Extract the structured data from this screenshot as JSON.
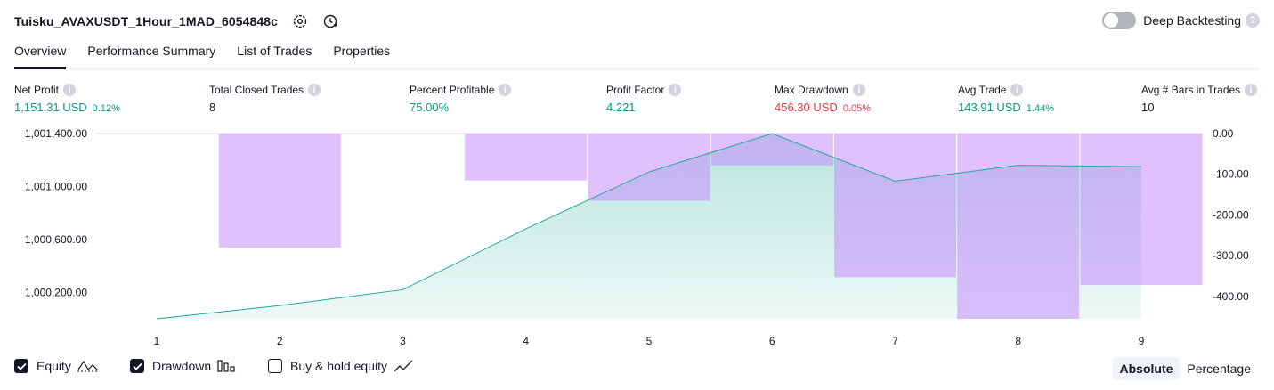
{
  "header": {
    "strategy_name": "Tuisku_AVAXUSDT_1Hour_1MAD_6054848c",
    "deep_backtesting_label": "Deep Backtesting",
    "deep_backtesting_on": false
  },
  "tabs": [
    {
      "label": "Overview",
      "active": true
    },
    {
      "label": "Performance Summary",
      "active": false
    },
    {
      "label": "List of Trades",
      "active": false
    },
    {
      "label": "Properties",
      "active": false
    }
  ],
  "stats": [
    {
      "label": "Net Profit",
      "value": "1,151.31 USD",
      "pct": "0.12%",
      "color": "green"
    },
    {
      "label": "Total Closed Trades",
      "value": "8",
      "pct": "",
      "color": "dark"
    },
    {
      "label": "Percent Profitable",
      "value": "75.00%",
      "pct": "",
      "color": "green"
    },
    {
      "label": "Profit Factor",
      "value": "4.221",
      "pct": "",
      "color": "green"
    },
    {
      "label": "Max Drawdown",
      "value": "456.30 USD",
      "pct": "0.05%",
      "color": "red"
    },
    {
      "label": "Avg Trade",
      "value": "143.91 USD",
      "pct": "1.44%",
      "color": "green"
    },
    {
      "label": "Avg # Bars in Trades",
      "value": "10",
      "pct": "",
      "color": "dark"
    }
  ],
  "chart_data": {
    "type": "area",
    "x": [
      1,
      2,
      3,
      4,
      5,
      6,
      7,
      8,
      9
    ],
    "left_axis": {
      "ticks": [
        "1,001,400.00",
        "1,001,000.00",
        "1,000,600.00",
        "1,000,200.00"
      ],
      "tick_values": [
        1001400,
        1001000,
        1000600,
        1000200
      ],
      "range": [
        1000000,
        1001400
      ]
    },
    "right_axis": {
      "ticks": [
        "0.00",
        "-100.00",
        "-200.00",
        "-300.00",
        "-400.00"
      ],
      "tick_values": [
        0,
        -100,
        -200,
        -300,
        -400
      ],
      "range": [
        -455,
        0
      ]
    },
    "series": [
      {
        "name": "Equity",
        "axis": "left",
        "values": [
          1000000,
          1000100,
          1000220,
          1000680,
          1001110,
          1001400,
          1001040,
          1001160,
          1001150
        ]
      },
      {
        "name": "Drawdown",
        "axis": "right",
        "values": [
          0,
          -280,
          0,
          -115,
          -165,
          -78,
          -353,
          -455,
          -372
        ]
      }
    ],
    "grid": false,
    "colors": {
      "equity_line": "#22ab94",
      "equity_fill": "#22ab94",
      "drawdown": "#c68cff",
      "baseline": "#f7cdea"
    }
  },
  "legend": [
    {
      "label": "Equity",
      "checked": true,
      "icon": "equity-line-icon"
    },
    {
      "label": "Drawdown",
      "checked": true,
      "icon": "drawdown-bars-icon"
    },
    {
      "label": "Buy & hold equity",
      "checked": false,
      "icon": "buy-hold-line-icon"
    }
  ],
  "mode": {
    "absolute_label": "Absolute",
    "percentage_label": "Percentage",
    "selected": "Absolute"
  }
}
